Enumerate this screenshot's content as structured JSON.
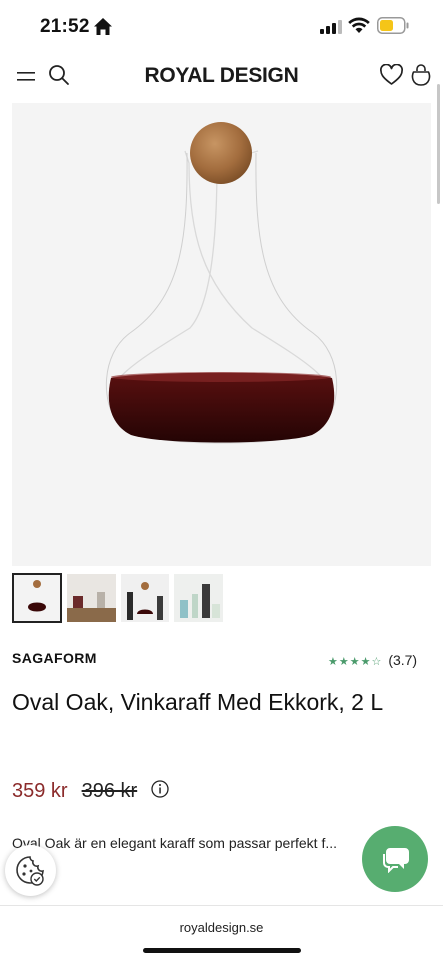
{
  "status_bar": {
    "time": "21:52"
  },
  "header": {
    "logo_text": "ROYAL DESIGN"
  },
  "gallery": {
    "thumbnail_count": 4,
    "active_index": 0
  },
  "product": {
    "brand": "SAGAFORM",
    "rating_stars": "★★★★☆",
    "rating_value": "(3.7)",
    "title": "Oval Oak, Vinkaraff Med Ekkork, 2 L",
    "price_current": "359 kr",
    "price_old": "396 kr",
    "description": "Oval Oak är en elegant karaff som passar perfekt f... atten."
  },
  "browser": {
    "domain": "royaldesign.se"
  },
  "colors": {
    "price_accent": "#8b2b2b",
    "rating_green": "#4a9a6b",
    "chat_green": "#57ad70",
    "battery_yellow": "#f5c518"
  },
  "icons": {
    "menu": "hamburger-icon",
    "search": "search-icon",
    "wishlist": "heart-icon",
    "cart": "bag-icon",
    "info": "info-icon",
    "cookie": "cookie-icon",
    "chat": "chat-icon"
  }
}
